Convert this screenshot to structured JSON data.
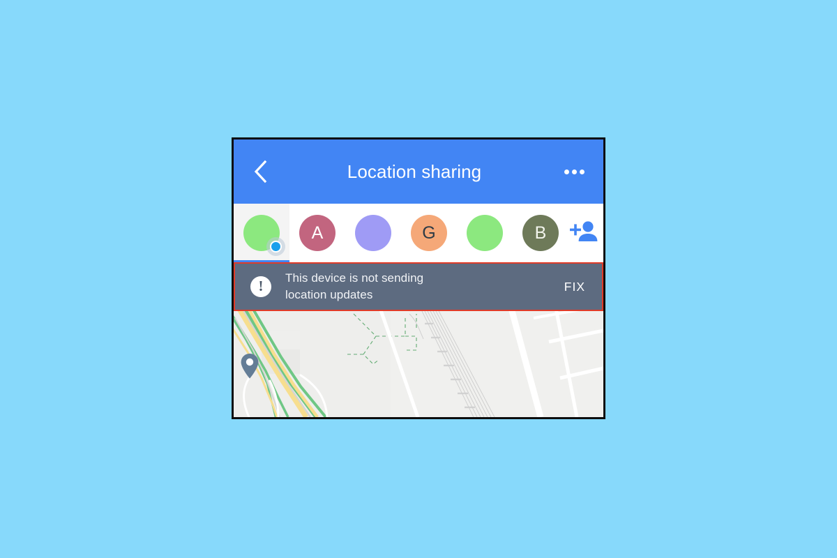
{
  "page": {
    "background_color": "#87d9fb"
  },
  "app": {
    "title": "Location sharing",
    "bar_color": "#4285f4",
    "back_icon": "chevron-left-icon",
    "overflow_icon": "more-horizontal-icon"
  },
  "people": {
    "selected_index": 0,
    "add_person_icon": "person-add-icon",
    "add_person_color": "#4285f4",
    "avatars": [
      {
        "label": "",
        "color": "#8ce87f",
        "text_color": "#ffffff",
        "selected": true,
        "has_status_dot": true,
        "status_dot_color": "#19a0ec",
        "name": "avatar-self"
      },
      {
        "label": "A",
        "color": "#c2657f",
        "text_color": "#ffffff",
        "selected": false,
        "has_status_dot": false,
        "name": "avatar-a"
      },
      {
        "label": "",
        "color": "#9f9bf5",
        "text_color": "#ffffff",
        "selected": false,
        "has_status_dot": false,
        "name": "avatar-purple"
      },
      {
        "label": "G",
        "color": "#f5a878",
        "text_color": "#2e3b46",
        "selected": false,
        "has_status_dot": false,
        "name": "avatar-g"
      },
      {
        "label": "",
        "color": "#8ce87f",
        "text_color": "#ffffff",
        "selected": false,
        "has_status_dot": false,
        "name": "avatar-green"
      },
      {
        "label": "B",
        "color": "#6e7a59",
        "text_color": "#f2f4ec",
        "selected": false,
        "has_status_dot": false,
        "name": "avatar-b"
      }
    ]
  },
  "alert": {
    "icon": "exclamation-circle-icon",
    "message_line_1": "This device is not sending",
    "message_line_2": "location updates",
    "action_label": "FIX",
    "background_color": "#5d6b80",
    "highlight_border_color": "#e03b28",
    "text_color": "#f1f3f6"
  },
  "map": {
    "background_color": "#eeeeec",
    "pin_icon": "map-pin-icon",
    "pin_color": "#647d96",
    "road_primary_color": "#f7de8f",
    "road_green_color": "#6fc785",
    "street_color": "#ffffff",
    "park_boundary_color": "#4aa05e",
    "rail_color": "#c9c9c9"
  }
}
